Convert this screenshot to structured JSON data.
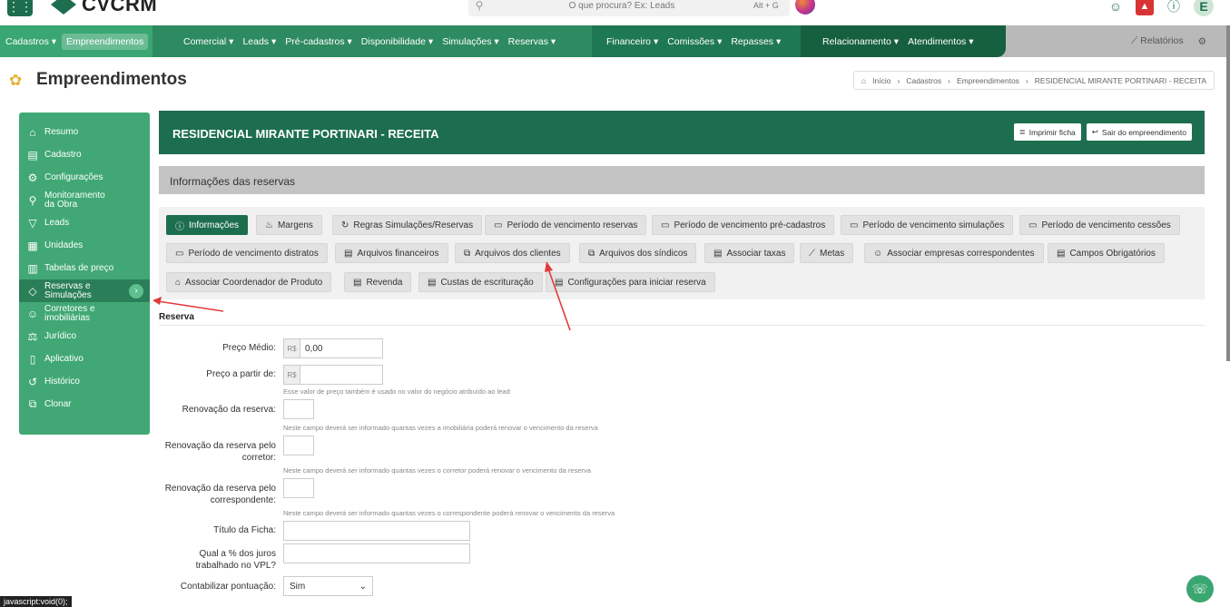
{
  "top": {
    "logo_text": "CVCRM",
    "search_placeholder": "O que procura? Ex: Leads",
    "search_shortcut": "Alt + G",
    "user_initial": "E"
  },
  "nav": {
    "a": [
      {
        "label": "Cadastros ▾"
      },
      {
        "label": "Empreendimentos"
      }
    ],
    "b": [
      {
        "label": "Comercial ▾"
      },
      {
        "label": "Leads ▾"
      },
      {
        "label": "Pré-cadastros ▾"
      },
      {
        "label": "Disponibilidade ▾"
      },
      {
        "label": "Simulações ▾"
      },
      {
        "label": "Reservas ▾"
      }
    ],
    "c": [
      {
        "label": "Financeiro ▾"
      },
      {
        "label": "Comissões ▾"
      },
      {
        "label": "Repasses ▾"
      }
    ],
    "d": [
      {
        "label": "Relacionamento ▾"
      },
      {
        "label": "Atendimentos ▾"
      }
    ],
    "right": {
      "reports": "Relatórios"
    }
  },
  "page": {
    "title": "Empreendimentos",
    "breadcrumb": [
      "Início",
      "Cadastros",
      "Empreendimentos",
      "RESIDENCIAL MIRANTE PORTINARI - RECEITA"
    ]
  },
  "sidebar": [
    {
      "icon": "⌂",
      "label": "Resumo"
    },
    {
      "icon": "▤",
      "label": "Cadastro"
    },
    {
      "icon": "⚙",
      "label": "Configurações"
    },
    {
      "icon": "⚲",
      "label": "Monitoramento da Obra"
    },
    {
      "icon": "▽",
      "label": "Leads"
    },
    {
      "icon": "▦",
      "label": "Unidades"
    },
    {
      "icon": "▥",
      "label": "Tabelas de preço"
    },
    {
      "icon": "◇",
      "label": "Reservas e Simulações"
    },
    {
      "icon": "☺",
      "label": "Corretores e imobiliárias"
    },
    {
      "icon": "⚖",
      "label": "Jurídico"
    },
    {
      "icon": "▯",
      "label": "Aplicativo"
    },
    {
      "icon": "↺",
      "label": "Histórico"
    },
    {
      "icon": "⧉",
      "label": "Clonar"
    }
  ],
  "hero": {
    "title": "RESIDENCIAL MIRANTE PORTINARI - RECEITA",
    "print": "Imprimir ficha",
    "exit": "Sair do empreendimento"
  },
  "infobar": "Informações das reservas",
  "tabs": [
    {
      "icon": "ⓘ",
      "label": "Informações"
    },
    {
      "icon": "♨",
      "label": "Margens"
    },
    {
      "icon": "↻",
      "label": "Regras Simulações/Reservas"
    },
    {
      "icon": "▭",
      "label": "Período de vencimento reservas"
    },
    {
      "icon": "▭",
      "label": "Período de vencimento pré-cadastros"
    },
    {
      "icon": "▭",
      "label": "Período de vencimento simulações"
    },
    {
      "icon": "▭",
      "label": "Período de vencimento cessões"
    },
    {
      "icon": "▭",
      "label": "Período de vencimento distratos"
    },
    {
      "icon": "▤",
      "label": "Arquivos financeiros"
    },
    {
      "icon": "⧉",
      "label": "Arquivos dos clientes"
    },
    {
      "icon": "⧉",
      "label": "Arquivos dos síndicos"
    },
    {
      "icon": "▤",
      "label": "Associar taxas"
    },
    {
      "icon": "⟋",
      "label": "Metas"
    },
    {
      "icon": "☺",
      "label": "Associar empresas correspondentes"
    },
    {
      "icon": "▤",
      "label": "Campos Obrigatórios"
    },
    {
      "icon": "⌂",
      "label": "Associar Coordenador de Produto"
    },
    {
      "icon": "▤",
      "label": "Revenda"
    },
    {
      "icon": "▤",
      "label": "Custas de escrituração"
    },
    {
      "icon": "▤",
      "label": "Configurações para iniciar reserva"
    }
  ],
  "form": {
    "section": "Reserva",
    "currency": "R$",
    "preco_medio_label": "Preço Médio:",
    "preco_medio_value": "0,00",
    "preco_apartir_label": "Preço a partir de:",
    "preco_help": "Esse valor de preço também é usado no valor do negócio atribuído ao lead",
    "renov_label": "Renovação da reserva:",
    "renov_help": "Neste campo deverá ser informado quantas vezes a imobiliária poderá renovar o vencimento da reserva",
    "renov_corretor_label": "Renovação da reserva pelo corretor:",
    "renov_corretor_help": "Neste campo deverá ser informado quantas vezes o corretor poderá renovar o vencimento da reserva",
    "renov_corresp_label": "Renovação da reserva pelo correspondente:",
    "renov_corresp_help": "Neste campo deverá ser informado quantas vezes o correspondente poderá renovar o vencimento da reserva",
    "titulo_label": "Título da Ficha:",
    "juros_label": "Qual a % dos juros trabalhado no VPL?",
    "pontuacao_label": "Contabilizar pontuação:",
    "pontuacao_value": "Sim"
  },
  "status": "javascript:void(0);"
}
